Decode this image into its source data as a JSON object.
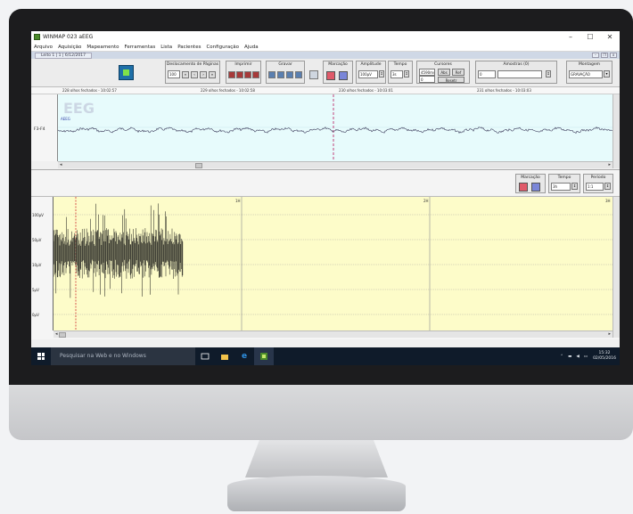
{
  "window": {
    "title": "WINMAP 023 aEEG",
    "controls": {
      "minimize": "–",
      "maximize": "☐",
      "close": "✕"
    }
  },
  "menu": [
    "Arquivo",
    "Aquisição",
    "Mapeamento",
    "Ferramentas",
    "Lista",
    "Pacientes",
    "Configuração",
    "Ajuda"
  ],
  "document_tab": {
    "label": "Leito 1 | 1 | 6/12/2017"
  },
  "toolbar": {
    "groups": {
      "deslocamento": "Deslocamento de Páginas",
      "imprimir": "Imprimir",
      "gravar": "Gravar",
      "marcacao": "Marcação",
      "amplitude": "Amplitude",
      "tempo": "Tempo",
      "cursores": "Cursores",
      "amostras": "Amostras (0)",
      "montagem": "Montagem"
    },
    "page_value": "100",
    "amplitude_value": "100µV",
    "tempo_value": "3s",
    "cursor_value": "4590ms",
    "cursor_subvalue": "0",
    "alt_label": "Abs",
    "ref_label": "Ref",
    "reset_label": "Resetr",
    "amostras_value": "0",
    "montagem_value": "GRAVAÇÃO"
  },
  "info_bar": [
    "228  olhos fechados - 10:02:57",
    "229  olhos fechados - 10:02:58",
    "230  olhos fechados - 10:03:01",
    "231  olhos fechados - 10:03:03"
  ],
  "eeg": {
    "title": "EEG",
    "channel": "F3-F4",
    "small_tag": "AEEG"
  },
  "mid_controls": {
    "marcacao": "Marcação",
    "tempo": "Tempo",
    "periodo": "Período",
    "tempo_value": "3h",
    "periodo_value": "1:1"
  },
  "spectrum": {
    "y_labels": [
      "100µV",
      "50µV",
      "10µV",
      "5µV",
      "0µV"
    ],
    "x_markers": [
      "1H",
      "2H",
      "3H"
    ]
  },
  "taskbar": {
    "search_placeholder": "Pesquisar na Web e no Windows",
    "time": "15:32",
    "date": "02/05/2016"
  },
  "colors": {
    "eeg_bg": "#e7fbfc",
    "spectrum_bg": "#fdfcc9",
    "marker": "#d0306a",
    "taskbar": "#0f1b2a"
  },
  "icons": [
    "app-icon",
    "windows-icon",
    "task-view-icon",
    "file-explorer-icon",
    "edge-icon",
    "winmap-icon",
    "network-icon",
    "speaker-icon",
    "notification-icon"
  ]
}
